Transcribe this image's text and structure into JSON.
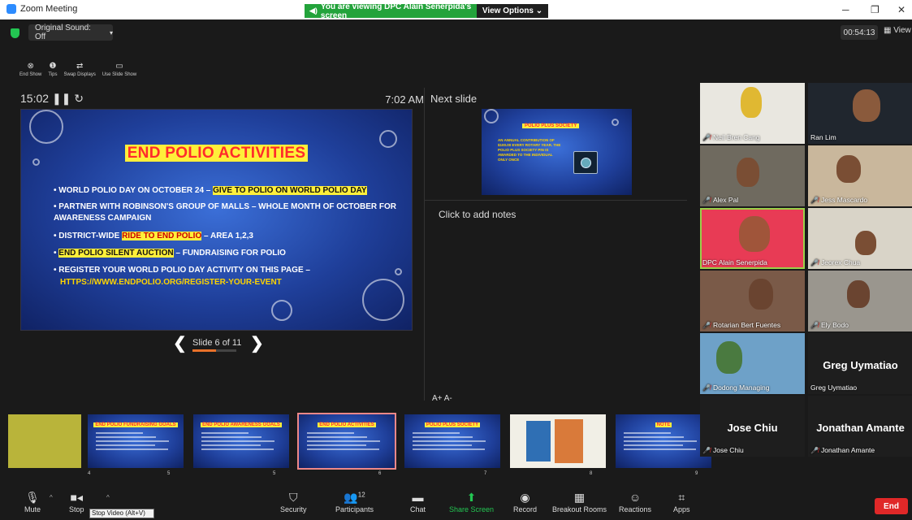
{
  "titlebar": {
    "app_title": "Zoom Meeting"
  },
  "banner": {
    "viewing_text": "You are viewing DPC Alain Senerpida's screen",
    "view_options": "View Options"
  },
  "topbar": {
    "original_sound": "Original Sound: Off",
    "timer": "00:54:13",
    "view_label": "View"
  },
  "presenter_tools": [
    {
      "label": "End Show",
      "icon": "end-show-icon"
    },
    {
      "label": "Tips",
      "icon": "tips-icon"
    },
    {
      "label": "Swap Displays",
      "icon": "swap-icon"
    },
    {
      "label": "Use Slide Show",
      "icon": "slideshow-icon"
    }
  ],
  "presenter": {
    "elapsed": "15:02",
    "clock": "7:02 AM",
    "slide_counter": "Slide 6 of 11",
    "progress": 0.545,
    "next_slide_label": "Next slide",
    "notes_placeholder": "Click to add notes",
    "font_controls": "A+  A-"
  },
  "slide": {
    "title": "END POLIO ACTIVITIES",
    "bullets": [
      {
        "pre": "WORLD POLIO DAY ON OCTOBER 24 – ",
        "hl": "GIVE TO POLIO ON WORLD POLIO DAY",
        "post": ""
      },
      {
        "pre": "PARTNER WITH ROBINSON'S GROUP OF MALLS – WHOLE MONTH OF OCTOBER FOR AWARENESS CAMPAIGN",
        "hl": "",
        "post": ""
      },
      {
        "pre": "DISTRICT-WIDE ",
        "hl": "RIDE TO END POLIO",
        "post": " – AREA 1,2,3"
      },
      {
        "pre": "",
        "hl": "END POLIO SILENT AUCTION",
        "post": " – FUNDRAISING FOR POLIO"
      },
      {
        "pre": "REGISTER YOUR WORLD POLIO DAY ACTIVITY ON THIS PAGE –",
        "hl": "",
        "post": ""
      }
    ],
    "url": "HTTPS://WWW.ENDPOLIO.ORG/REGISTER-YOUR-EVENT"
  },
  "next_slide": {
    "title": "POLIO PLUS SOCIETY",
    "text": "AN ANNUAL CONTRIBUTION OF $100.00 EVERY ROTARY YEAR. THE POLIO PLUS SOCIETY PIN IS AWARDED TO THE INDIVIDUAL ONLY ONCE"
  },
  "thumbnails": [
    {
      "num": "4",
      "title": "",
      "kind": "yellow"
    },
    {
      "num": "5",
      "title": "END POLIO FUNDRAISING GOALS",
      "kind": "text"
    },
    {
      "num": "5",
      "title": "END POLIO AWARENESS GOALS",
      "kind": "text"
    },
    {
      "num": "6",
      "title": "END POLIO ACTIVITIES",
      "kind": "text"
    },
    {
      "num": "7",
      "title": "POLIO PLUS SOCIETY",
      "kind": "text"
    },
    {
      "num": "8",
      "title": "",
      "kind": "photo"
    },
    {
      "num": "9",
      "title": "NOTE",
      "kind": "text"
    }
  ],
  "participants": [
    {
      "name": "Neil Bren Cang",
      "muted": true
    },
    {
      "name": "Ran Lim",
      "muted": false
    },
    {
      "name": "Alex Pal",
      "muted": true
    },
    {
      "name": "Jess Mascardo",
      "muted": true
    },
    {
      "name": "DPC Alain Senerpida",
      "muted": false
    },
    {
      "name": "Jeorex Chua",
      "muted": true
    },
    {
      "name": "Rotarian Bert Fuentes",
      "muted": true
    },
    {
      "name": "Ely Bodo",
      "muted": true
    },
    {
      "name": "Dodong Managing",
      "muted": true
    },
    {
      "name": "Greg Uymatiao",
      "muted": false
    },
    {
      "name": "Jose Chiu",
      "muted": true
    },
    {
      "name": "Jonathan Amante",
      "muted": true
    }
  ],
  "toolbar": {
    "mute": "Mute",
    "stop_video": "Stop",
    "tooltip": "Stop Video (Alt+V)",
    "security": "Security",
    "participants": "Participants",
    "participants_count": "12",
    "chat": "Chat",
    "share_screen": "Share Screen",
    "record": "Record",
    "breakout": "Breakout Rooms",
    "reactions": "Reactions",
    "apps": "Apps",
    "end": "End"
  },
  "colors": {
    "share_green": "#23a33b",
    "end_red": "#e02828",
    "highlight_yellow": "#ffef3a",
    "slide_title_red": "#ff2b2b",
    "zoom_blue": "#2d8cff"
  }
}
